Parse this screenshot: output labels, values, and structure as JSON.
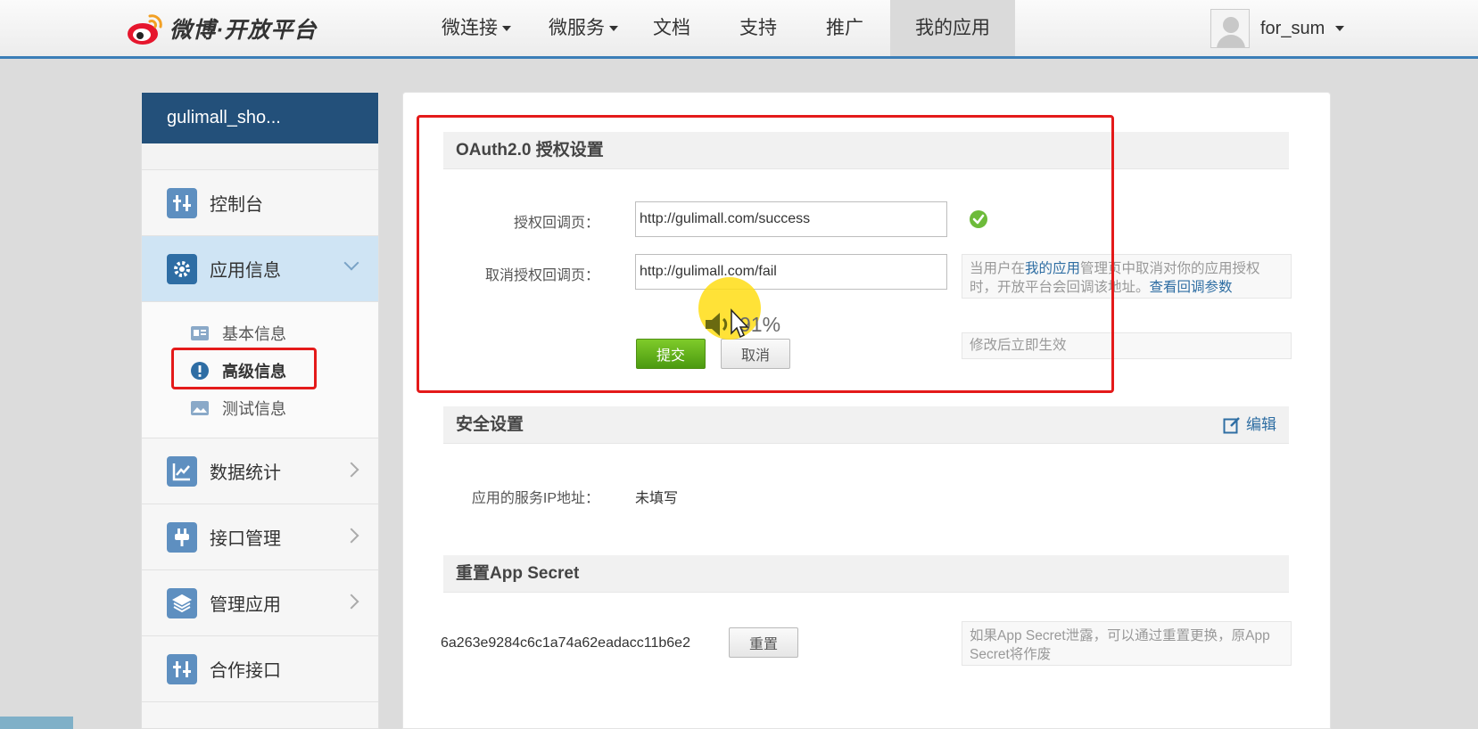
{
  "header": {
    "logo_text": "微博·开放平台",
    "nav": [
      {
        "label": "微连接",
        "has_caret": true
      },
      {
        "label": "微服务",
        "has_caret": true
      },
      {
        "label": "文档",
        "has_caret": false
      },
      {
        "label": "支持",
        "has_caret": false
      },
      {
        "label": "推广",
        "has_caret": false
      },
      {
        "label": "我的应用",
        "has_caret": false,
        "active": true
      }
    ],
    "username": "for_sum"
  },
  "sidebar": {
    "app_name": "gulimall_sho...",
    "items": [
      {
        "label": "控制台",
        "icon": "console-icon"
      },
      {
        "label": "应用信息",
        "icon": "gear-icon",
        "expanded": true
      },
      {
        "label": "数据统计",
        "icon": "chart-icon"
      },
      {
        "label": "接口管理",
        "icon": "plug-icon"
      },
      {
        "label": "管理应用",
        "icon": "layers-icon"
      },
      {
        "label": "合作接口",
        "icon": "console-icon"
      }
    ],
    "sub_items": [
      {
        "label": "基本信息",
        "icon": "id-card-icon"
      },
      {
        "label": "高级信息",
        "icon": "exclamation-icon",
        "active": true
      },
      {
        "label": "测试信息",
        "icon": "picture-icon"
      }
    ]
  },
  "oauth": {
    "title": "OAuth2.0 授权设置",
    "callback_label": "授权回调页：",
    "callback_value": "http://gulimall.com/success",
    "cancel_callback_label": "取消授权回调页：",
    "cancel_callback_value": "http://gulimall.com/fail",
    "hint_pre": "当用户在",
    "hint_link": "我的应用",
    "hint_mid": "管理页中取消对你的应用授权时，开放平台会回调该地址。",
    "hint_link2": "查看回调参数",
    "submit_label": "提交",
    "cancel_label": "取消",
    "effect_hint": "修改后立即生效"
  },
  "security": {
    "title": "安全设置",
    "edit_label": "编辑",
    "ip_label": "应用的服务IP地址：",
    "ip_value": "未填写"
  },
  "secret": {
    "title": "重置App Secret",
    "value": "6a263e9284c6c1a74a62eadacc11b6e2",
    "reset_label": "重置",
    "hint": "如果App Secret泄露，可以通过重置更换，原App Secret将作废"
  },
  "overlay": {
    "volume_text": "91%"
  },
  "colors": {
    "header_border": "#3b7eb7",
    "sidebar_title_bg": "#23507a",
    "highlight_red": "#e41a1a",
    "primary_green": "#5aa818",
    "link_blue": "#2f6ea3"
  }
}
